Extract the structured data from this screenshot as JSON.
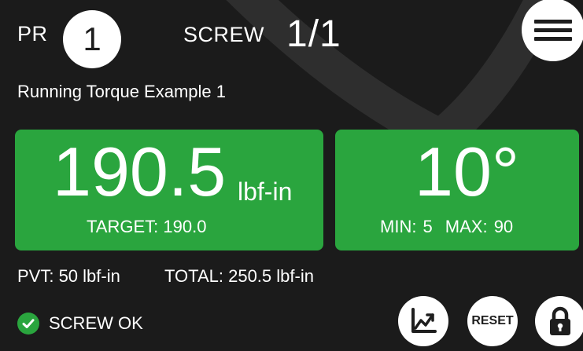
{
  "header": {
    "pr_label": "PR",
    "pr_value": "1",
    "screw_label": "SCREW",
    "screw_count": "1/1",
    "menu_icon": "hamburger-menu-icon"
  },
  "program": {
    "name": "Running Torque Example 1"
  },
  "torque": {
    "value": "190.5",
    "unit": "lbf-in",
    "target": "TARGET: 190.0"
  },
  "angle": {
    "value": "10°",
    "min": "MIN: 5",
    "max": "MAX: 90"
  },
  "totals": {
    "pvt": "PVT: 50 lbf-in",
    "total": "TOTAL: 250.5 lbf-in"
  },
  "status": {
    "text": "SCREW OK",
    "icon": "check-circle-icon"
  },
  "actions": {
    "graph_icon": "graph-icon",
    "reset_label": "RESET",
    "lock_icon": "lock-icon"
  },
  "colors": {
    "background": "#1b1b1b",
    "panel_ok": "#2aa53e",
    "button": "#ffffff"
  }
}
